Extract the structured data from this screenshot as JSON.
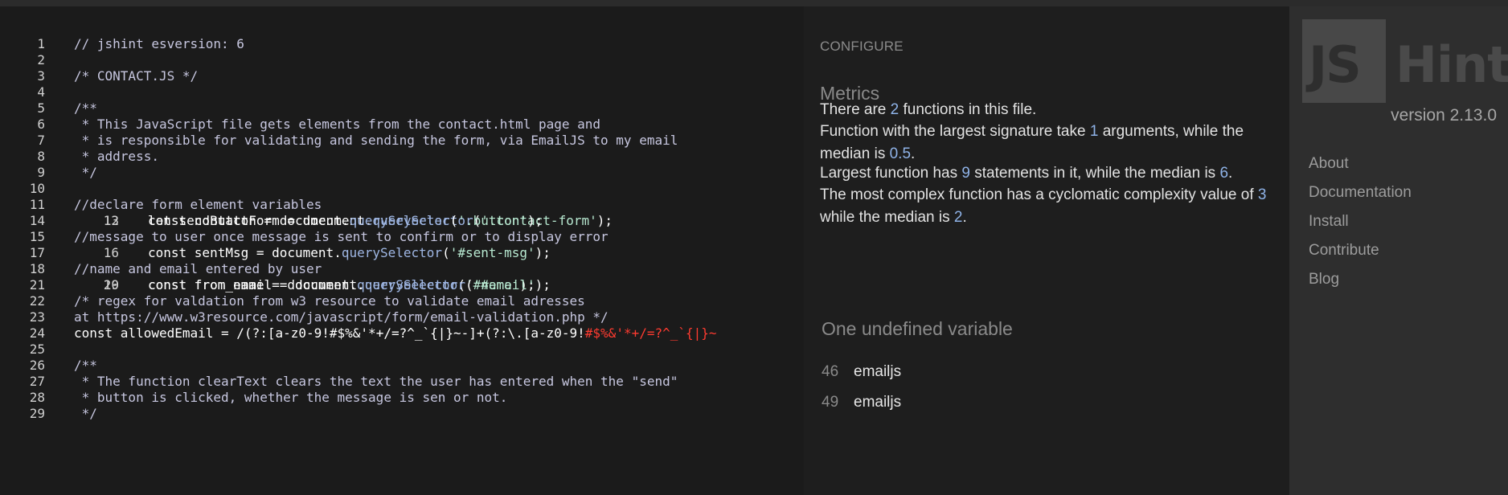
{
  "editor": {
    "lines": [
      {
        "n": "1",
        "type": "comment",
        "text": "// jshint esversion: 6"
      },
      {
        "n": "2",
        "type": "blank",
        "text": ""
      },
      {
        "n": "3",
        "type": "comment",
        "text": "/* CONTACT.JS */"
      },
      {
        "n": "4",
        "type": "blank",
        "text": ""
      },
      {
        "n": "5",
        "type": "comment",
        "text": "/**"
      },
      {
        "n": "6",
        "type": "comment",
        "text": " * This JavaScript file gets elements from the contact.html page and"
      },
      {
        "n": "7",
        "type": "comment",
        "text": " * is responsible for validating and sending the form, via EmailJS to my email"
      },
      {
        "n": "8",
        "type": "comment",
        "text": " * address."
      },
      {
        "n": "9",
        "type": "comment",
        "text": " */"
      },
      {
        "n": "10",
        "type": "blank",
        "text": ""
      },
      {
        "n": "11",
        "type": "comment",
        "text": "//declare form element variables"
      },
      {
        "n": "12",
        "type": "code",
        "pre": "const contactForm = document.",
        "method": "querySelector",
        "paren": "(",
        "str": "'.contact-form'",
        "post": ");"
      },
      {
        "n": "13",
        "type": "code",
        "pre": "let sendButton = document.",
        "method": "querySelector",
        "paren": "(",
        "str": "'.button'",
        "post": ");"
      },
      {
        "n": "14",
        "type": "blank",
        "text": ""
      },
      {
        "n": "15",
        "type": "comment",
        "text": "//message to user once message is sent to confirm or to display error"
      },
      {
        "n": "16",
        "type": "code",
        "pre": "const sentMsg = document.",
        "method": "querySelector",
        "paren": "(",
        "str": "'#sent-msg'",
        "post": ");"
      },
      {
        "n": "17",
        "type": "blank",
        "text": ""
      },
      {
        "n": "18",
        "type": "comment",
        "text": "//name and email entered by user"
      },
      {
        "n": "19",
        "type": "code",
        "pre": "const from_name = document.",
        "method": "querySelector",
        "paren": "(",
        "str": "'#name'",
        "post": ");"
      },
      {
        "n": "20",
        "type": "code",
        "pre": "const from_email = document.",
        "method": "querySelector",
        "paren": "(",
        "str": "'#email'",
        "post": ");"
      },
      {
        "n": "21",
        "type": "blank",
        "text": ""
      },
      {
        "n": "22",
        "type": "comment",
        "text": "/* regex for valdation from w3 resource to validate email adresses"
      },
      {
        "n": "23",
        "type": "comment",
        "text": "at https://www.w3resource.com/javascript/form/email-validation.php */"
      },
      {
        "n": "24",
        "type": "regex",
        "pre": "const allowedEmail = ",
        "regex": "/(?:[a-z0-9!#$%&'*+/=?^_`{|}~-]+(?:\\.[a-z0-9!",
        "err": "#$%&'*+/=?^_`{|}~"
      },
      {
        "n": "25",
        "type": "blank",
        "text": ""
      },
      {
        "n": "26",
        "type": "comment",
        "text": "/**"
      },
      {
        "n": "27",
        "type": "comment",
        "text": " * The function clearText clears the text the user has entered when the \"send\""
      },
      {
        "n": "28",
        "type": "comment",
        "text": " * button is clicked, whether the message is sen or not."
      },
      {
        "n": "29",
        "type": "comment",
        "text": " */"
      }
    ]
  },
  "report": {
    "configure_label": "CONFIGURE",
    "metrics_title": "Metrics",
    "m1": {
      "a": "There are ",
      "n": "2",
      "b": " functions in this file."
    },
    "m2": {
      "a": "Function with the largest signature take ",
      "n1": "1",
      "b": " arguments, while the median is ",
      "n2": "0.5",
      "c": "."
    },
    "m3": {
      "a": "Largest function has ",
      "n1": "9",
      "b": " statements in it, while the median is ",
      "n2": "6",
      "c": "."
    },
    "m4": {
      "a": "The most complex function has a cyclomatic complexity value of ",
      "n1": "3",
      "b": " while the median is ",
      "n2": "2",
      "c": "."
    },
    "undefined_title": "One undefined variable",
    "undefined": [
      {
        "line": "46",
        "name": "emailjs"
      },
      {
        "line": "49",
        "name": "emailjs"
      }
    ]
  },
  "sidebar": {
    "logo_js": "JS",
    "logo_hint": "Hint",
    "version": "version 2.13.0",
    "nav": [
      "About",
      "Documentation",
      "Install",
      "Contribute",
      "Blog"
    ]
  },
  "colors": {
    "background": "#1e1e1e",
    "sidebar": "#2e2e2e",
    "number_accent": "#8fb3e8",
    "error": "#ff3b30"
  }
}
